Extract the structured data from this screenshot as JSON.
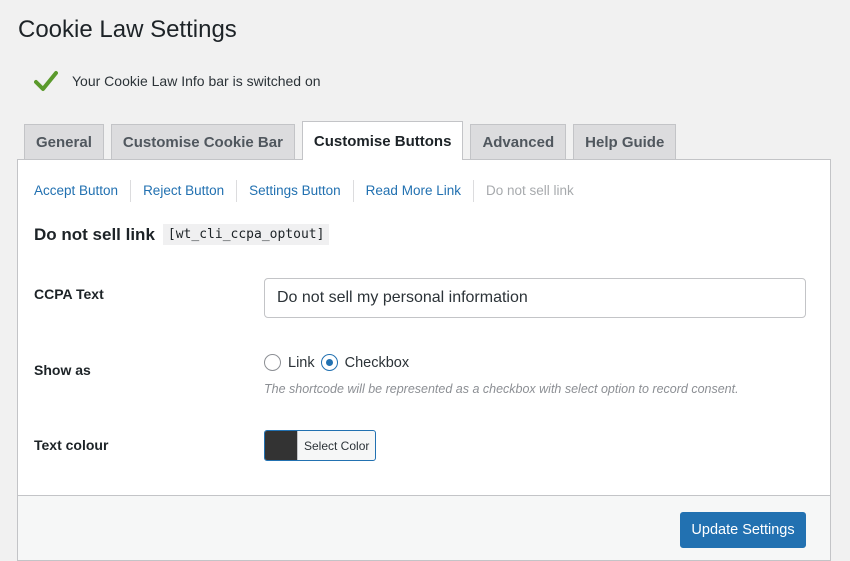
{
  "page": {
    "title": "Cookie Law Settings"
  },
  "notice": {
    "icon": "check-icon",
    "text": "Your Cookie Law Info bar is switched on",
    "icon_color": "#5b9a2c"
  },
  "tabs": [
    {
      "label": "General",
      "active": false
    },
    {
      "label": "Customise Cookie Bar",
      "active": false
    },
    {
      "label": "Customise Buttons",
      "active": true
    },
    {
      "label": "Advanced",
      "active": false
    },
    {
      "label": "Help Guide",
      "active": false
    }
  ],
  "subnav": [
    {
      "label": "Accept Button",
      "current": false
    },
    {
      "label": "Reject Button",
      "current": false
    },
    {
      "label": "Settings Button",
      "current": false
    },
    {
      "label": "Read More Link",
      "current": false
    },
    {
      "label": "Do not sell link",
      "current": true
    }
  ],
  "section": {
    "title": "Do not sell link",
    "shortcode": "[wt_cli_ccpa_optout]"
  },
  "fields": {
    "ccpa_text": {
      "label": "CCPA Text",
      "value": "Do not sell my personal information"
    },
    "show_as": {
      "label": "Show as",
      "options": [
        "Link",
        "Checkbox"
      ],
      "selected": "Checkbox",
      "description": "The shortcode will be represented as a checkbox with select option to record consent."
    },
    "text_colour": {
      "label": "Text colour",
      "button_label": "Select Color",
      "value": "#333333"
    }
  },
  "footer": {
    "update_label": "Update Settings"
  },
  "colors": {
    "accent": "#2271b1",
    "link": "#2271b1"
  }
}
